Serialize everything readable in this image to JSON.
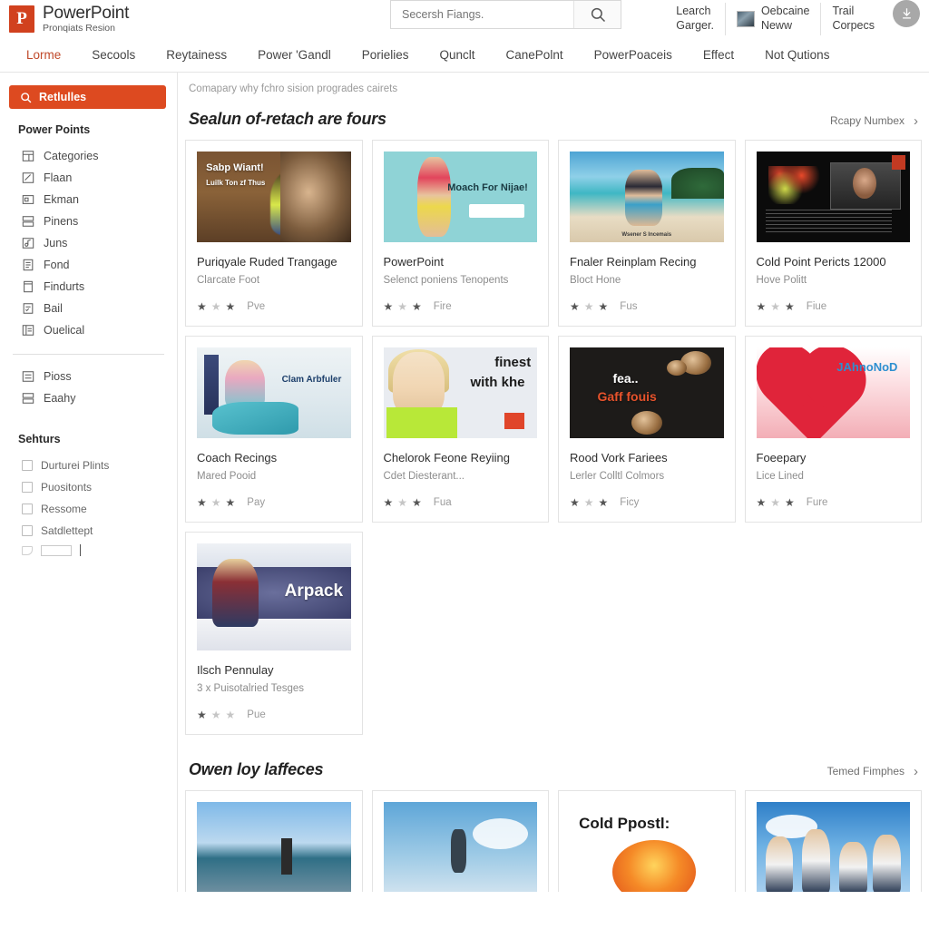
{
  "header": {
    "brand_logo_letter": "P",
    "brand_title": "PowerPoint",
    "brand_subtitle": "Pronqiats Resion",
    "search_placeholder": "Secersh Fiangs.",
    "search_icon": "search-icon",
    "actions": [
      {
        "line1": "Learch",
        "line2": "Garger.",
        "has_thumb": false
      },
      {
        "line1": "Oebcaine",
        "line2": "Neww",
        "has_thumb": true
      },
      {
        "line1": "Trail",
        "line2": "Corpecs",
        "has_thumb": false
      }
    ],
    "download_icon": "download-icon"
  },
  "nav": {
    "items": [
      {
        "label": "Lorme",
        "active": true
      },
      {
        "label": "Secools",
        "active": false
      },
      {
        "label": "Reytainess",
        "active": false
      },
      {
        "label": "Power 'Gandl",
        "active": false
      },
      {
        "label": "Porielies",
        "active": false
      },
      {
        "label": "Qunclt",
        "active": false
      },
      {
        "label": "CanePolnt",
        "active": false
      },
      {
        "label": "PowerPoaceis",
        "active": false
      },
      {
        "label": "Effect",
        "active": false
      },
      {
        "label": "Not Qutions",
        "active": false
      }
    ]
  },
  "sidebar": {
    "search_button": {
      "label": "Retlulles",
      "icon": "search-icon",
      "color": "#dd4a20"
    },
    "group_title": "Power Points",
    "items": [
      {
        "label": "Categories",
        "icon": "list-icon"
      },
      {
        "label": "Flaan",
        "icon": "edit-icon"
      },
      {
        "label": "Ekman",
        "icon": "frame-icon"
      },
      {
        "label": "Pinens",
        "icon": "layers-icon"
      },
      {
        "label": "Juns",
        "icon": "music-icon"
      },
      {
        "label": "Fond",
        "icon": "document-icon"
      },
      {
        "label": "Findurts",
        "icon": "page-icon"
      },
      {
        "label": "Bail",
        "icon": "form-icon"
      },
      {
        "label": "Ouelical",
        "icon": "board-icon"
      }
    ],
    "items2": [
      {
        "label": "Pioss",
        "icon": "list-icon"
      },
      {
        "label": "Eaahy",
        "icon": "layers-icon"
      }
    ],
    "filters_title": "Sehturs",
    "filters": [
      {
        "label": "Durturei Plints",
        "checked": false
      },
      {
        "label": "Puositonts",
        "checked": false
      },
      {
        "label": "Ressome",
        "checked": false
      },
      {
        "label": "Satdlettept",
        "checked": false
      }
    ]
  },
  "main": {
    "breadcrumb": "Comapary why fchro sision progrades cairets",
    "sections": [
      {
        "title": "Sealun of-retach are fours",
        "more_label": "Rcapy Numbex",
        "more_icon": "chevron-right-icon",
        "cards": [
          {
            "title": "Puriqyale Ruded Trangage",
            "subtitle": "Clarcate Foot",
            "rating_label": "Pve",
            "stars": 3,
            "filled": [
              1,
              0,
              1
            ],
            "art": "art-wood",
            "caption1": "Sabp Wiant!",
            "caption2": "Luilk Ton zf Thus"
          },
          {
            "title": "PowerPoint",
            "subtitle": "Selenct poniens Tenopents",
            "rating_label": "Fire",
            "stars": 3,
            "filled": [
              1,
              0,
              1
            ],
            "art": "art-teal",
            "caption1": "Moach For Nijae!",
            "caption2": ""
          },
          {
            "title": "Fnaler Reinplam Recing",
            "subtitle": "Bloct Hone",
            "rating_label": "Fus",
            "stars": 3,
            "filled": [
              1,
              0,
              1
            ],
            "art": "art-beach",
            "caption1": "",
            "caption2": "Wsener S Incemais"
          },
          {
            "title": "Cold Point Pericts 12000",
            "subtitle": "Hove Politt",
            "rating_label": "Fiue",
            "stars": 3,
            "filled": [
              1,
              0,
              1
            ],
            "art": "art-dark",
            "caption1": "",
            "caption2": ""
          }
        ]
      },
      {
        "cards2": [
          {
            "title": "Coach Recings",
            "subtitle": "Mared Pooid",
            "rating_label": "Pay",
            "stars": 3,
            "filled": [
              1,
              0,
              1
            ],
            "art": "art-room",
            "caption1": "Clam Arbfuler",
            "caption2": ""
          },
          {
            "title": "Chelorok Feone Reyiing",
            "subtitle": "Cdet Diesterant...",
            "rating_label": "Fua",
            "stars": 3,
            "filled": [
              1,
              0,
              1
            ],
            "art": "art-girl",
            "caption1": "finest",
            "caption2": "with khe"
          },
          {
            "title": "Rood Vork Fariees",
            "subtitle": "Lerler Colltl Colmors",
            "rating_label": "Ficy",
            "stars": 3,
            "filled": [
              1,
              0,
              1
            ],
            "art": "art-coffee",
            "caption1": "fea..",
            "caption2": "Gaff fouis"
          },
          {
            "title": "Foeepary",
            "subtitle": "Lice Lined",
            "rating_label": "Fure",
            "stars": 3,
            "filled": [
              1,
              0,
              1
            ],
            "art": "art-heart",
            "caption1": "JAhnoNoD",
            "caption2": ""
          }
        ],
        "cards3": [
          {
            "title": "Ilsch Pennulay",
            "subtitle": "3 x Puisotalried Tesges",
            "rating_label": "Pue",
            "stars": 3,
            "filled": [
              1,
              0,
              1
            ],
            "art": "art-snow",
            "caption1": "Arpack",
            "caption2": ""
          }
        ]
      },
      {
        "title": "Owen loy laffeces",
        "more_label": "Temed Fimphes",
        "more_icon": "chevron-right-icon",
        "cards": [
          {
            "title": "",
            "subtitle": "",
            "rating_label": "",
            "art": "art-sea1",
            "caption1": "",
            "caption2": ""
          },
          {
            "title": "",
            "subtitle": "",
            "rating_label": "",
            "art": "art-sea2",
            "caption1": "",
            "caption2": ""
          },
          {
            "title": "",
            "subtitle": "",
            "rating_label": "",
            "art": "art-white",
            "caption1": "Cold Ppostl:",
            "caption2": ""
          },
          {
            "title": "",
            "subtitle": "",
            "rating_label": "",
            "art": "art-sky",
            "caption1": "",
            "caption2": ""
          }
        ]
      }
    ]
  }
}
